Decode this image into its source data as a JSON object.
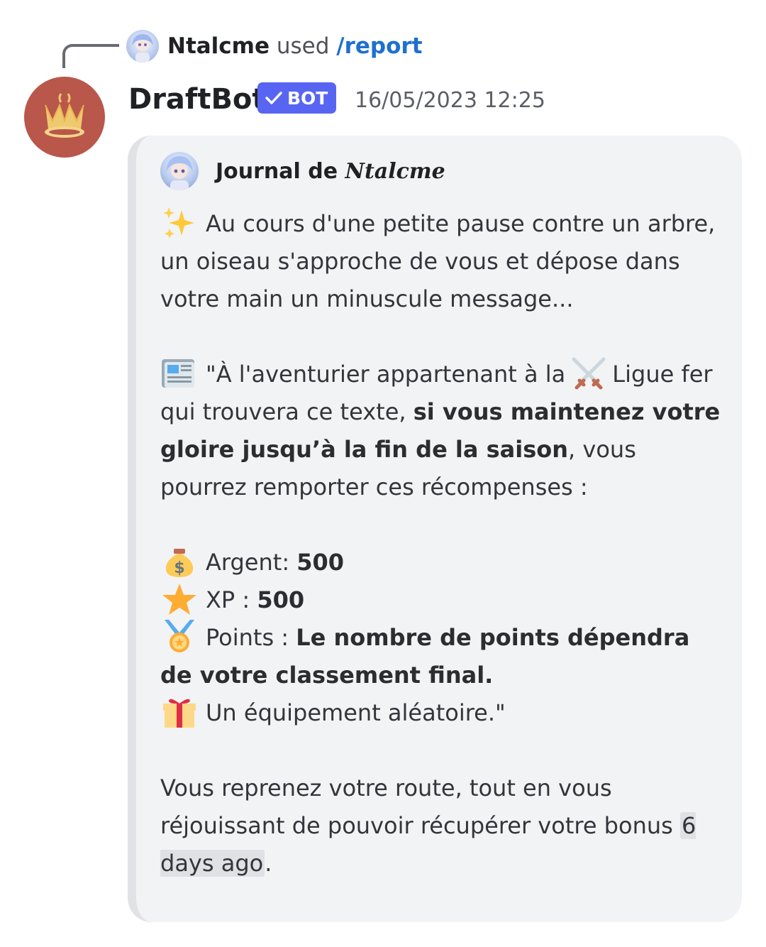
{
  "reply": {
    "user": "Ntalcme",
    "used": "used",
    "command": "/report"
  },
  "message": {
    "author": "DraftBot",
    "badge": "BOT",
    "timestamp": "16/05/2023 12:25"
  },
  "embed": {
    "author_prefix": "Journal de",
    "author_name": "Ntalcme",
    "intro": "Au cours d'une petite pause contre un arbre, un oiseau s'approche de vous et dépose dans votre main un minuscule message...",
    "letter_part1": "\"À l'aventurier appartenant à la",
    "letter_part2": "Ligue fer qui trouvera ce texte,",
    "letter_bold": "si vous maintenez votre gloire jusqu’à la fin de la saison",
    "letter_part3": ", vous pourrez remporter ces récompenses :",
    "rewards": [
      {
        "icon": "money-bag-icon",
        "label": "Argent:",
        "value": "500"
      },
      {
        "icon": "star-icon",
        "label": "XP :",
        "value": "500"
      },
      {
        "icon": "medal-icon",
        "label": "Points :",
        "value": "Le nombre de points dépendra de votre classement final."
      },
      {
        "icon": "gift-icon",
        "label": "Un équipement aléatoire.\"",
        "value": ""
      }
    ],
    "outro": "Vous reprenez votre route, tout en vous réjouissant de pouvoir récupérer votre bonus",
    "relative_time": "6 days ago",
    "outro_end": "."
  }
}
